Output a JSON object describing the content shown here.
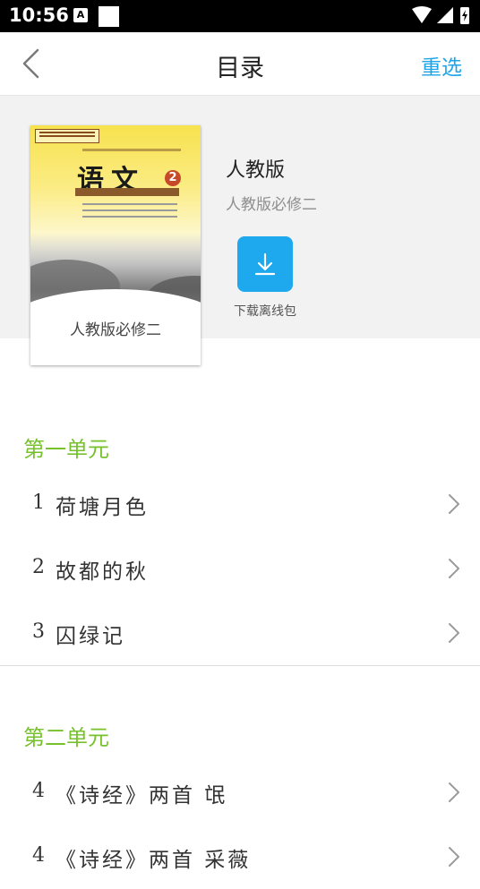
{
  "status_bar": {
    "time": "10:56",
    "notification_letter": "A"
  },
  "nav": {
    "title": "目录",
    "action_label": "重选"
  },
  "book": {
    "edition": "人教版",
    "subtitle": "人教版必修二",
    "cover_title": "语文",
    "cover_volume": "2",
    "cover_label": "人教版必修二",
    "download_label": "下载离线包"
  },
  "catalog": {
    "units": [
      {
        "title": "第一单元",
        "lessons": [
          {
            "num": "1",
            "title": "荷塘月色"
          },
          {
            "num": "2",
            "title": "故都的秋"
          },
          {
            "num": "3",
            "title": "囚绿记"
          }
        ]
      },
      {
        "title": "第二单元",
        "lessons": [
          {
            "num": "4",
            "title": "《诗经》两首 氓"
          },
          {
            "num": "4",
            "title": "《诗经》两首 采薇"
          }
        ]
      }
    ]
  },
  "colors": {
    "accent": "#1ea5e8",
    "unit_title": "#76c12c",
    "download_button": "#1ea8ee"
  }
}
